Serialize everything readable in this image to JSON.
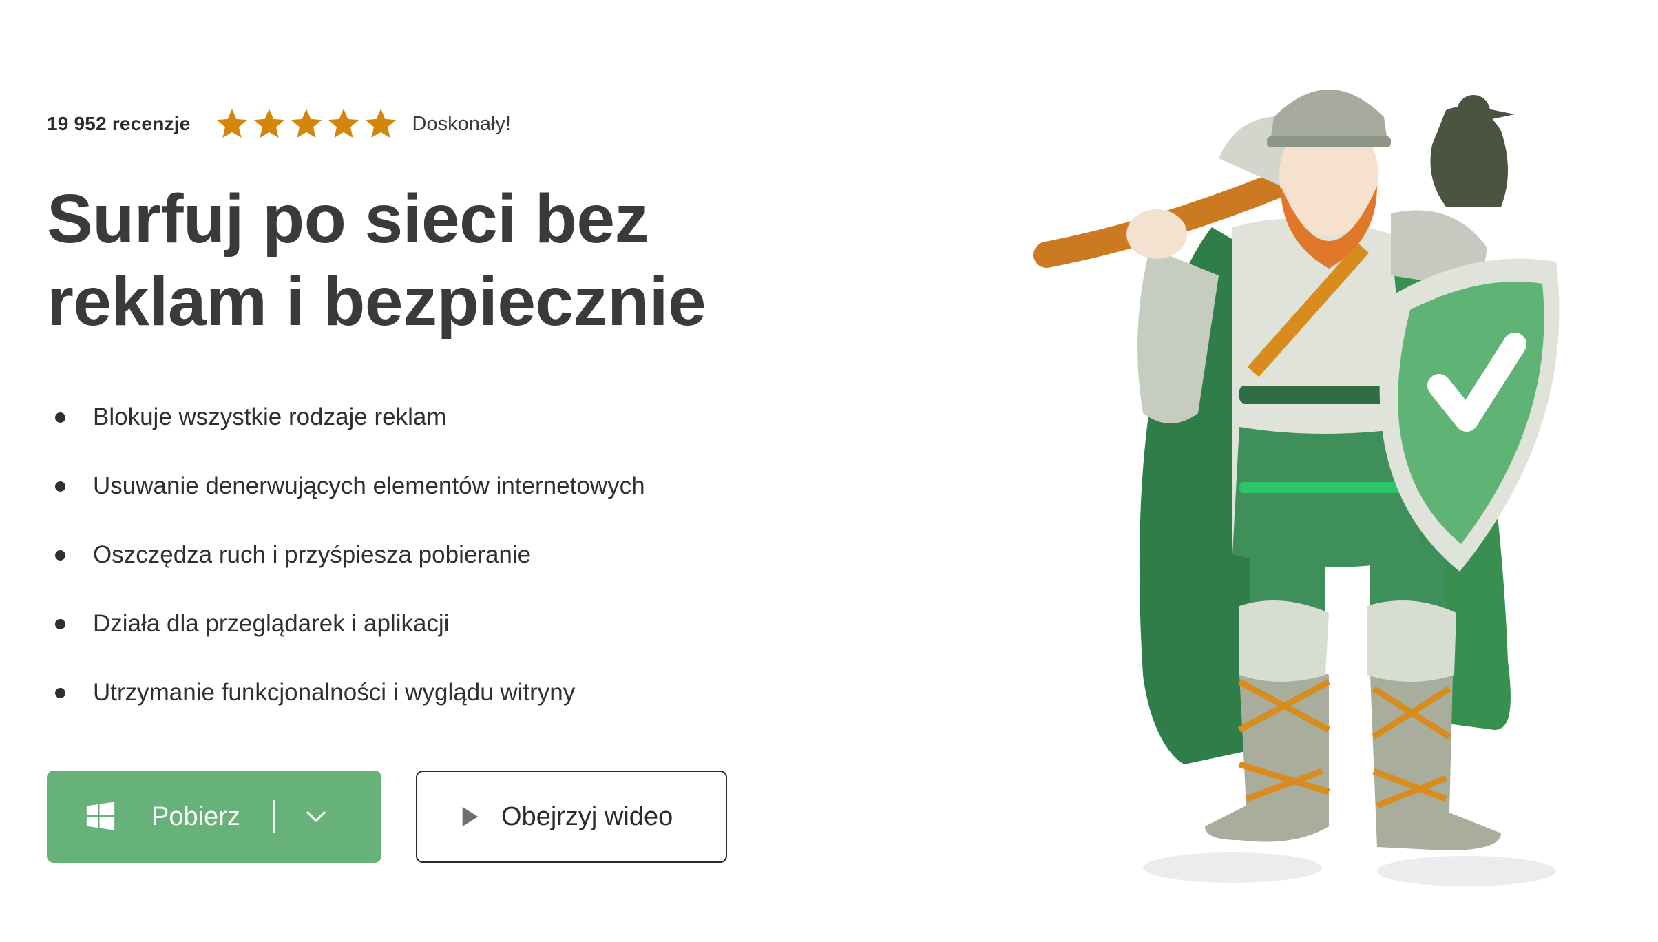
{
  "rating": {
    "review_count": "19 952 recenzje",
    "stars": 5,
    "star_color": "#d4860b",
    "label": "Doskonały!"
  },
  "headline": {
    "line1": "Surfuj po sieci bez",
    "line2": "reklam i bezpiecznie"
  },
  "features": [
    "Blokuje wszystkie rodzaje reklam",
    "Usuwanie denerwujących elementów internetowych",
    "Oszczędza ruch i przyśpiesza pobieranie",
    "Działa dla przeglądarek i aplikacji",
    "Utrzymanie funkcjonalności i wyglądu witryny"
  ],
  "buttons": {
    "download": {
      "label": "Pobierz",
      "icon": "windows-icon",
      "dropdown_icon": "chevron-down-icon",
      "color": "#67b279"
    },
    "video": {
      "label": "Obejrzyj wideo",
      "icon": "play-icon"
    }
  },
  "illustration": {
    "subject": "viking-mascot",
    "shield_icon": "check-shield-icon",
    "accent": "#3f8f5a"
  }
}
